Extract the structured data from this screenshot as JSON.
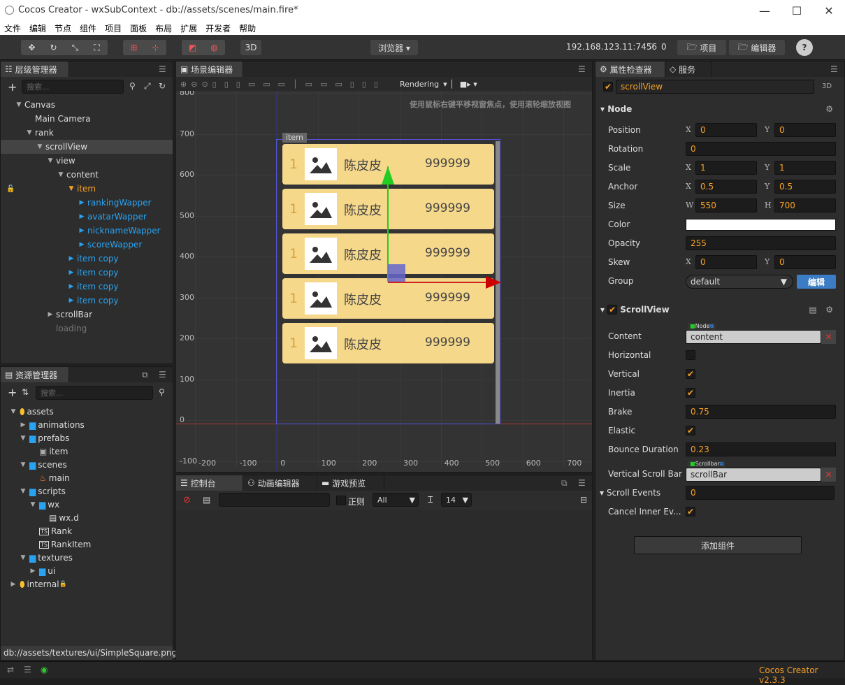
{
  "window": {
    "title": "Cocos Creator - wxSubContext - db://assets/scenes/main.fire*",
    "minimize": "—",
    "maximize": "☐",
    "close": "✕"
  },
  "menu": [
    "文件",
    "编辑",
    "节点",
    "组件",
    "项目",
    "面板",
    "布局",
    "扩展",
    "开发者",
    "帮助"
  ],
  "toolbar": {
    "mode3d": "3D",
    "preview": "浏览器 ▾",
    "ip": "192.168.123.11:7456",
    "clients": "0",
    "project": "项目",
    "editor": "编辑器",
    "help": "?"
  },
  "hierarchy": {
    "title": "层级管理器",
    "search_placeholder": "搜索...",
    "items": [
      {
        "label": "Canvas",
        "depth": 0,
        "arrow": "▼",
        "cls": ""
      },
      {
        "label": "Main Camera",
        "depth": 1,
        "arrow": "",
        "cls": ""
      },
      {
        "label": "rank",
        "depth": 1,
        "arrow": "▼",
        "cls": ""
      },
      {
        "label": "scrollView",
        "depth": 2,
        "arrow": "▼",
        "cls": "sel"
      },
      {
        "label": "view",
        "depth": 3,
        "arrow": "▼",
        "cls": ""
      },
      {
        "label": "content",
        "depth": 4,
        "arrow": "▼",
        "cls": ""
      },
      {
        "label": "item",
        "depth": 5,
        "arrow": "▼",
        "cls": "orange"
      },
      {
        "label": "rankingWapper",
        "depth": 6,
        "arrow": "▶",
        "cls": "blue"
      },
      {
        "label": "avatarWapper",
        "depth": 6,
        "arrow": "▶",
        "cls": "blue"
      },
      {
        "label": "nicknameWapper",
        "depth": 6,
        "arrow": "▶",
        "cls": "blue"
      },
      {
        "label": "scoreWapper",
        "depth": 6,
        "arrow": "▶",
        "cls": "blue"
      },
      {
        "label": "item copy",
        "depth": 5,
        "arrow": "▶",
        "cls": "blue"
      },
      {
        "label": "item copy",
        "depth": 5,
        "arrow": "▶",
        "cls": "blue"
      },
      {
        "label": "item copy",
        "depth": 5,
        "arrow": "▶",
        "cls": "blue"
      },
      {
        "label": "item copy",
        "depth": 5,
        "arrow": "▶",
        "cls": "blue"
      },
      {
        "label": "scrollBar",
        "depth": 3,
        "arrow": "▶",
        "cls": ""
      },
      {
        "label": "loading",
        "depth": 3,
        "arrow": "",
        "cls": "gray"
      }
    ]
  },
  "assets": {
    "title": "资源管理器",
    "search_placeholder": "搜索...",
    "items": [
      {
        "label": "assets",
        "depth": 0,
        "arrow": "▼",
        "icon": "db"
      },
      {
        "label": "animations",
        "depth": 1,
        "arrow": "▶",
        "icon": "folder"
      },
      {
        "label": "prefabs",
        "depth": 1,
        "arrow": "▼",
        "icon": "folder"
      },
      {
        "label": "item",
        "depth": 2,
        "arrow": "",
        "icon": "prefab"
      },
      {
        "label": "scenes",
        "depth": 1,
        "arrow": "▼",
        "icon": "folder"
      },
      {
        "label": "main",
        "depth": 2,
        "arrow": "",
        "icon": "fire"
      },
      {
        "label": "scripts",
        "depth": 1,
        "arrow": "▼",
        "icon": "folder"
      },
      {
        "label": "wx",
        "depth": 2,
        "arrow": "▼",
        "icon": "folder"
      },
      {
        "label": "wx.d",
        "depth": 3,
        "arrow": "",
        "icon": "doc"
      },
      {
        "label": "Rank",
        "depth": 2,
        "arrow": "",
        "icon": "ts"
      },
      {
        "label": "RankItem",
        "depth": 2,
        "arrow": "",
        "icon": "ts"
      },
      {
        "label": "textures",
        "depth": 1,
        "arrow": "▼",
        "icon": "folder"
      },
      {
        "label": "ui",
        "depth": 2,
        "arrow": "▶",
        "icon": "folder"
      },
      {
        "label": "internal",
        "depth": 0,
        "arrow": "▶",
        "icon": "db"
      }
    ],
    "path": "db://assets/textures/ui/SimpleSquare.png"
  },
  "scene": {
    "title": "场景编辑器",
    "rendering": "Rendering",
    "hint": "使用鼠标右键平移视窗焦点，使用滚轮缩放视图",
    "item_label": "item",
    "yaxis": [
      "800",
      "700",
      "600",
      "500",
      "400",
      "300",
      "200",
      "100",
      "0",
      "-100"
    ],
    "xaxis": [
      "-200",
      "-100",
      "0",
      "100",
      "200",
      "300",
      "400",
      "500",
      "600",
      "700"
    ],
    "cards": [
      {
        "rank": "1",
        "name": "陈皮皮",
        "score": "999999"
      },
      {
        "rank": "1",
        "name": "陈皮皮",
        "score": "999999"
      },
      {
        "rank": "1",
        "name": "陈皮皮",
        "score": "999999"
      },
      {
        "rank": "1",
        "name": "陈皮皮",
        "score": "999999"
      },
      {
        "rank": "1",
        "name": "陈皮皮",
        "score": "999999"
      }
    ]
  },
  "console": {
    "tabs": [
      "控制台",
      "动画编辑器",
      "游戏预览"
    ],
    "regex": "正则",
    "level": "All",
    "fontsize": "14"
  },
  "inspector": {
    "title": "属性检查器",
    "service": "服务",
    "node_name": "scrollView",
    "mode3d": "3D",
    "node_section": "Node",
    "props": {
      "position_label": "Position",
      "position_x": "0",
      "position_y": "0",
      "rotation_label": "Rotation",
      "rotation": "0",
      "scale_label": "Scale",
      "scale_x": "1",
      "scale_y": "1",
      "anchor_label": "Anchor",
      "anchor_x": "0.5",
      "anchor_y": "0.5",
      "size_label": "Size",
      "size_w": "550",
      "size_h": "700",
      "color_label": "Color",
      "color": "#ffffff",
      "opacity_label": "Opacity",
      "opacity": "255",
      "skew_label": "Skew",
      "skew_x": "0",
      "skew_y": "0",
      "group_label": "Group",
      "group": "default",
      "edit": "编辑"
    },
    "xy": {
      "x": "X",
      "y": "Y",
      "w": "W",
      "h": "H"
    },
    "scrollview_section": "ScrollView",
    "sv": {
      "content_label": "Content",
      "content_tag": "Node",
      "content": "content",
      "horizontal_label": "Horizontal",
      "horizontal": false,
      "vertical_label": "Vertical",
      "vertical": true,
      "inertia_label": "Inertia",
      "inertia": true,
      "brake_label": "Brake",
      "brake": "0.75",
      "elastic_label": "Elastic",
      "elastic": true,
      "bounce_label": "Bounce Duration",
      "bounce": "0.23",
      "vsb_label": "Vertical Scroll Bar",
      "vsb_tag": "Scrollbar",
      "vsb": "scrollBar",
      "events_label": "Scroll Events",
      "events": "0",
      "cancel_label": "Cancel Inner Ev...",
      "cancel": true
    },
    "add_component": "添加组件"
  },
  "status": {
    "version": "Cocos Creator v2.3.3"
  },
  "colors": {
    "accent": "#f9a127",
    "blue": "#29a3f0",
    "card": "#f6d88b"
  }
}
